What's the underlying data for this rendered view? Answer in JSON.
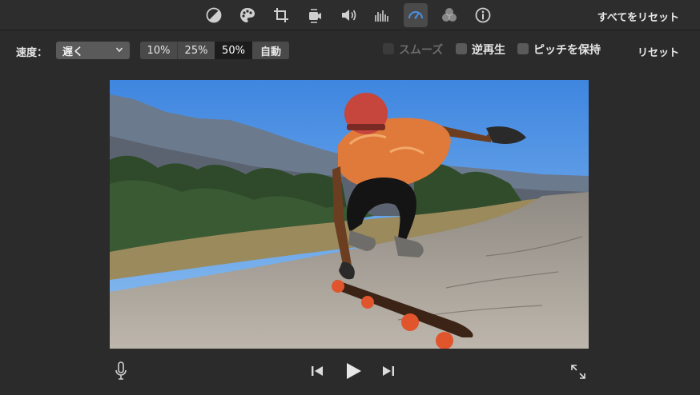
{
  "toolbar": {
    "icons": [
      {
        "name": "color-balance-icon"
      },
      {
        "name": "color-correction-icon"
      },
      {
        "name": "crop-icon"
      },
      {
        "name": "stabilization-icon"
      },
      {
        "name": "volume-icon"
      },
      {
        "name": "equalizer-icon"
      },
      {
        "name": "speed-icon",
        "active": true
      },
      {
        "name": "filter-icon"
      },
      {
        "name": "info-icon"
      }
    ],
    "reset_all_label": "すべてをリセット"
  },
  "speed": {
    "label": "速度：",
    "select_value": "遅く",
    "segments": [
      {
        "label": "10%",
        "selected": false
      },
      {
        "label": "25%",
        "selected": false
      },
      {
        "label": "50%",
        "selected": true
      },
      {
        "label": "自動",
        "selected": false
      }
    ],
    "options": [
      {
        "label": "スムーズ",
        "checked": false,
        "enabled": false
      },
      {
        "label": "逆再生",
        "checked": false,
        "enabled": true
      },
      {
        "label": "ピッチを保持",
        "checked": false,
        "enabled": true
      }
    ],
    "reset_label": "リセット"
  },
  "colors": {
    "background": "#2b2b2b",
    "accent": "#4a90e2",
    "selected_segment": "#1c1c1c"
  },
  "controls": {
    "icons": [
      "microphone-icon",
      "skip-back-icon",
      "play-icon",
      "skip-forward-icon",
      "fullscreen-icon"
    ]
  }
}
